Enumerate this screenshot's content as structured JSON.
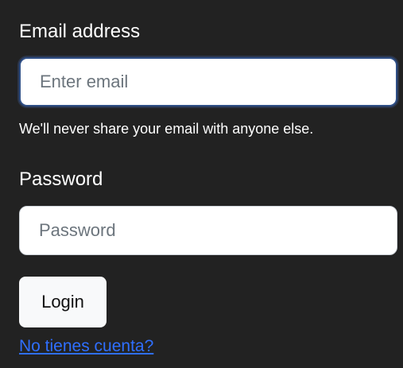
{
  "form": {
    "email_label": "Email address",
    "email_placeholder": "Enter email",
    "email_help": "We'll never share your email with anyone else.",
    "password_label": "Password",
    "password_placeholder": "Password",
    "login_button": "Login",
    "signup_link": "No tienes cuenta?"
  },
  "colors": {
    "panel_background": "#222222",
    "text": "#ffffff",
    "link": "#2f6fff",
    "focus_border": "#2f4f86",
    "button_background": "#f8f9fa"
  }
}
